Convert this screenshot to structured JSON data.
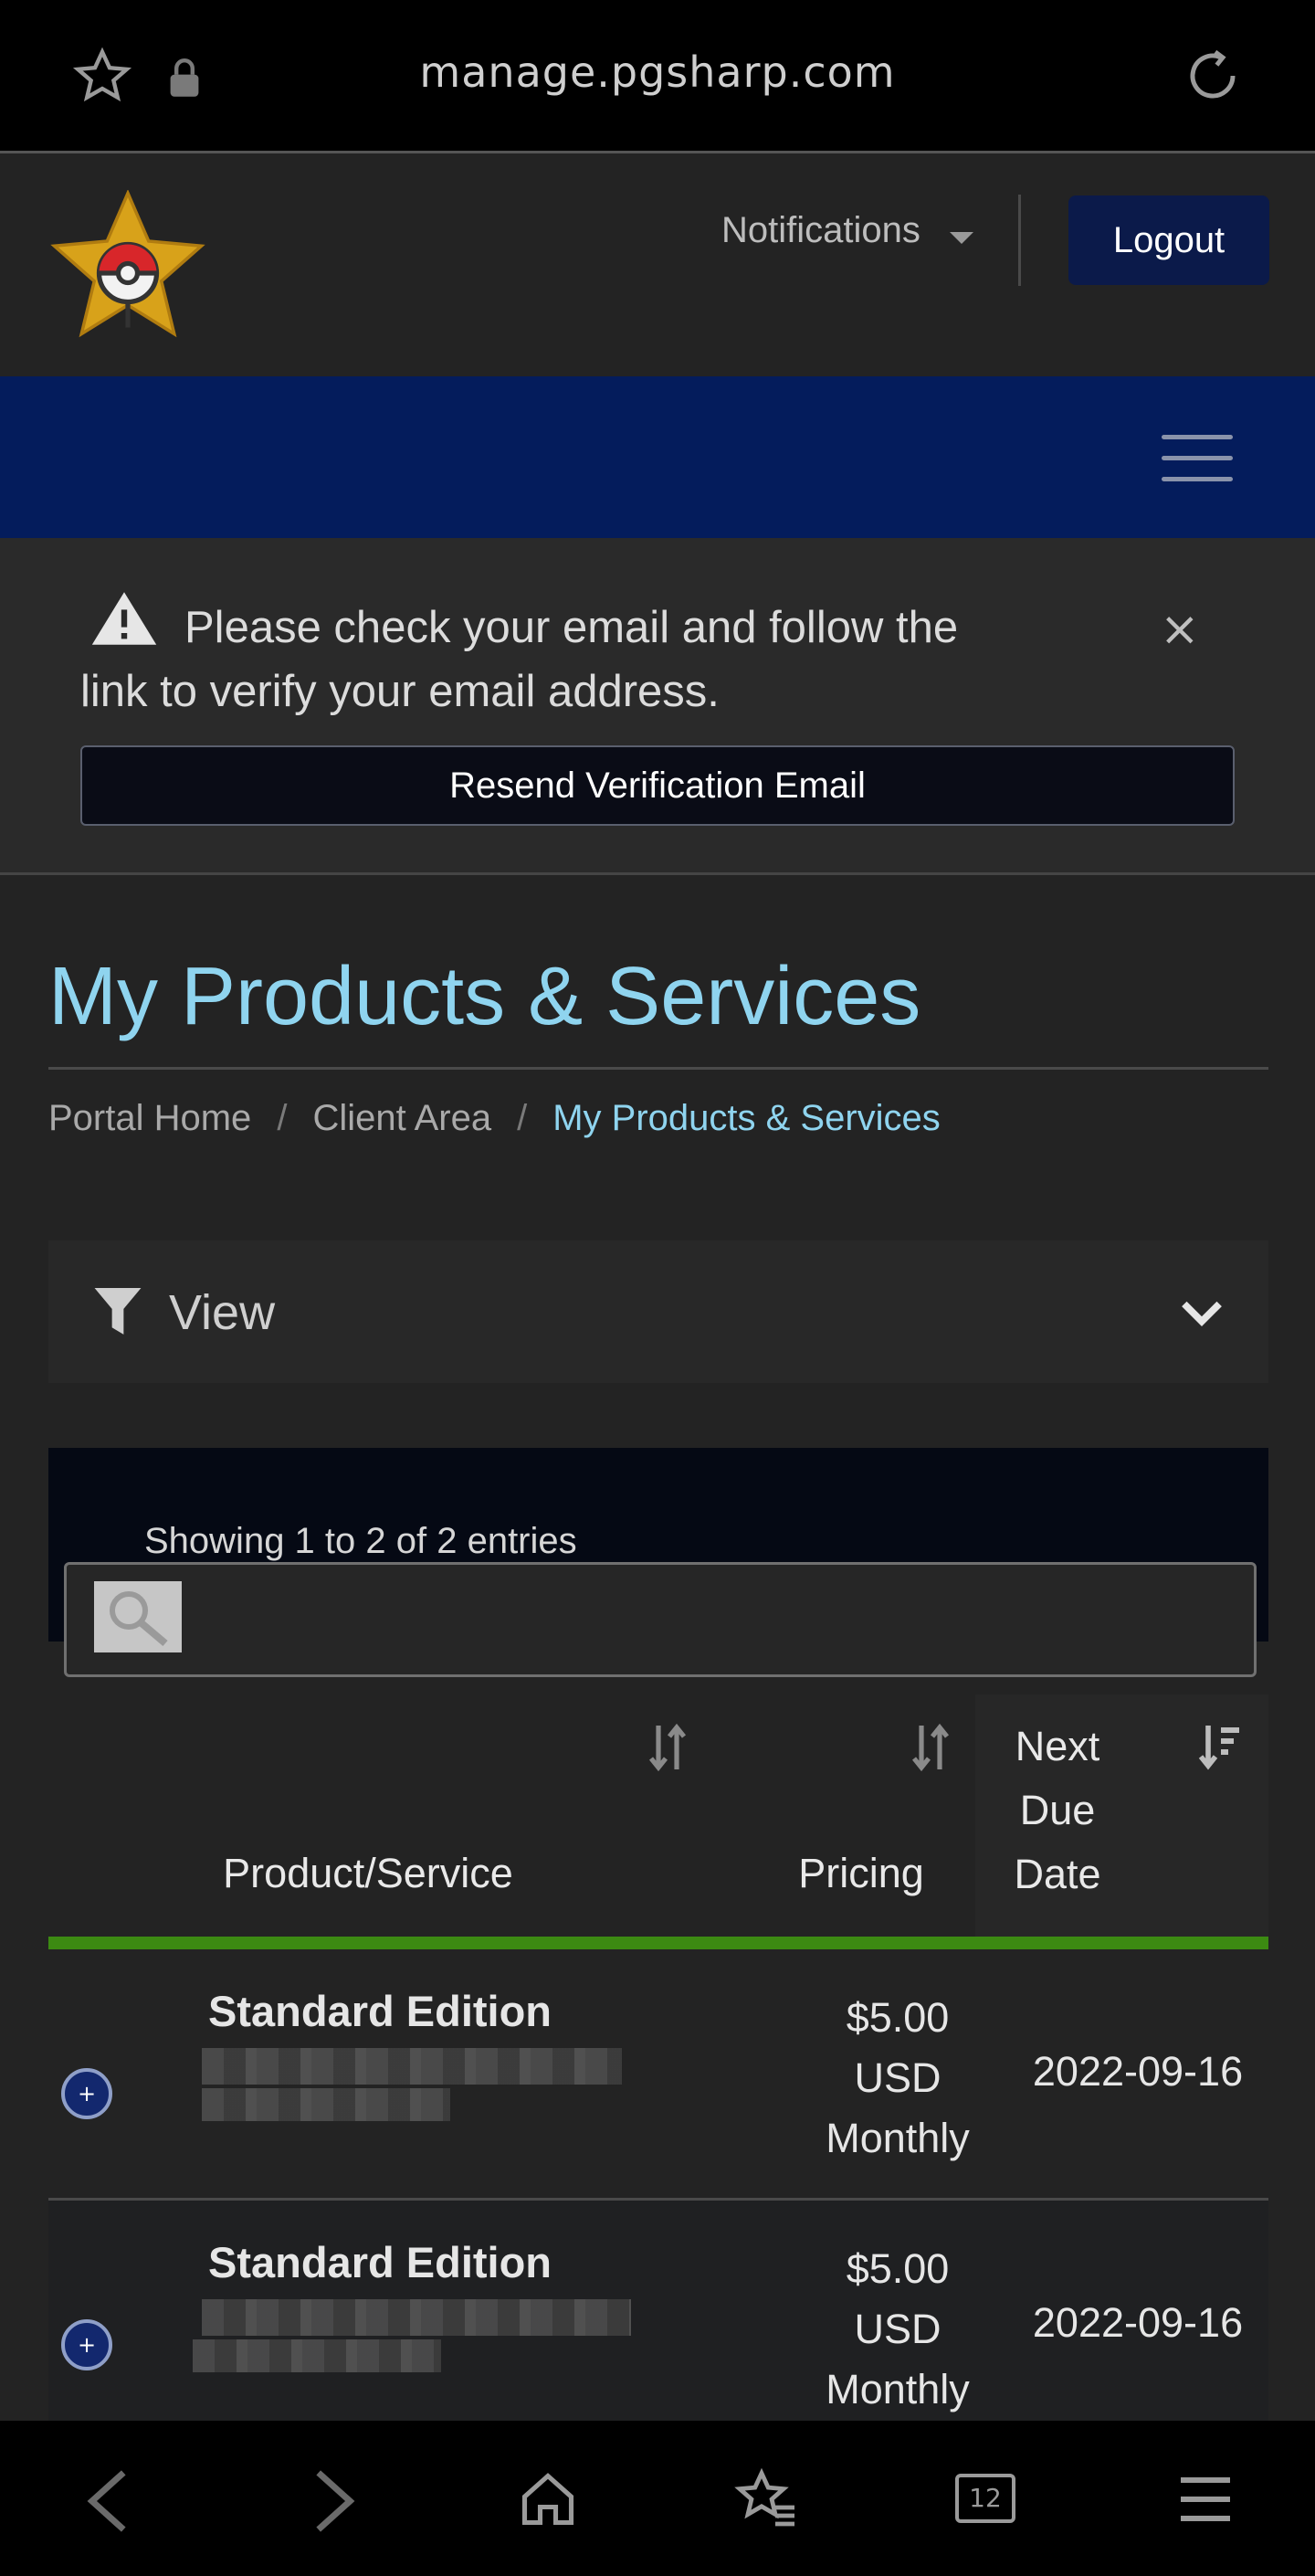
{
  "browser": {
    "url": "manage.pgsharp.com",
    "tab_count": "12",
    "icons": [
      "star-icon",
      "lock-icon",
      "reload-icon",
      "back-icon",
      "forward-icon",
      "home-icon",
      "bookmarks-icon",
      "tabs-icon",
      "menu-icon"
    ]
  },
  "header": {
    "notifications_label": "Notifications",
    "logout_label": "Logout"
  },
  "alert": {
    "message": "Please check your email and follow the link to verify your email address.",
    "close_glyph": "×",
    "resend_label": "Resend Verification Email"
  },
  "page": {
    "title": "My Products & Services",
    "breadcrumb": [
      "Portal Home",
      "Client Area",
      "My Products & Services"
    ],
    "breadcrumb_sep": "/"
  },
  "view_filter": {
    "label": "View"
  },
  "table": {
    "showing_text": "Showing 1 to 2 of 2 entries",
    "columns": [
      "Product/Service",
      "Pricing",
      "Next\nDue\nDate"
    ],
    "rows": [
      {
        "expand": "+",
        "product": "Standard Edition",
        "pricing": "$5.00\nUSD\nMonthly",
        "next_due": "2022-09-16"
      },
      {
        "expand": "+",
        "product": "Standard Edition",
        "pricing": "$5.00\nUSD\nMonthly",
        "next_due": "2022-09-16"
      }
    ]
  },
  "colors": {
    "title_blue": "#8fd4ef",
    "nav_band": "#041c5c",
    "logout_bg": "#0b1a4a",
    "header_rule_green": "#3c8a12"
  }
}
